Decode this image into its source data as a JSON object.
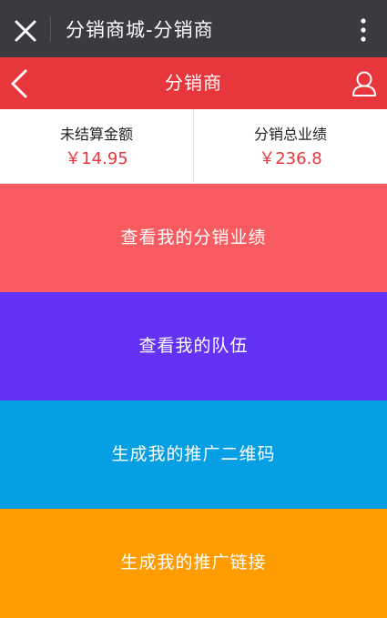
{
  "top_bar": {
    "title": "分销商城-分销商",
    "icons": {
      "close": "close-icon",
      "more": "more-vertical-icon"
    }
  },
  "header": {
    "title": "分销商",
    "icons": {
      "back": "chevron-left-icon",
      "user": "user-icon"
    },
    "color": "#e8373c"
  },
  "stats": {
    "unsettled": {
      "label": "未结算金额",
      "value": "￥14.95"
    },
    "total": {
      "label": "分销总业绩",
      "value": "￥236.8"
    }
  },
  "menu": {
    "performance": {
      "label": "查看我的分销业绩",
      "color": "#f95c60"
    },
    "team": {
      "label": "查看我的队伍",
      "color": "#6332f6"
    },
    "qrcode": {
      "label": "生成我的推广二维码",
      "color": "#069fe3"
    },
    "link": {
      "label": "生成我的推广链接",
      "color": "#ff9c00"
    }
  }
}
